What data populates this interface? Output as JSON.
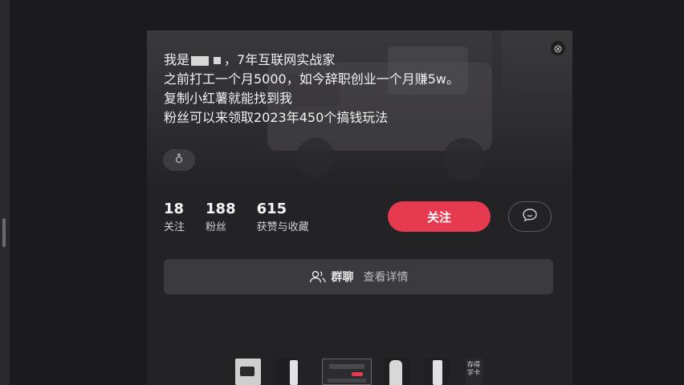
{
  "profile": {
    "bio_lines": [
      "，7年互联网实战家",
      "之前打工一个月5000，如今辞职创业一个月赚5w。",
      "复制小红薯就能找到我",
      "粉丝可以来领取2023年450个搞钱玩法"
    ],
    "bio_prefix": "我是",
    "tag_icon": "gender-icon"
  },
  "stats": {
    "following_count": "18",
    "following_label": "关注",
    "followers_count": "188",
    "followers_label": "粉丝",
    "likes_count": "615",
    "likes_label": "获赞与收藏"
  },
  "actions": {
    "follow_label": "关注",
    "chat_icon": "chat-bubble-icon"
  },
  "group_chat": {
    "icon": "group-users-icon",
    "title": "群聊",
    "detail": "查看详情"
  },
  "thumbnails": [
    {
      "type": "image"
    },
    {
      "type": "image"
    },
    {
      "type": "image"
    },
    {
      "type": "image"
    },
    {
      "type": "image"
    },
    {
      "type": "text",
      "text": "存得学卡"
    }
  ],
  "colors": {
    "accent": "#e53a4f",
    "background": "#1b1a1c",
    "panel": "#232225"
  }
}
